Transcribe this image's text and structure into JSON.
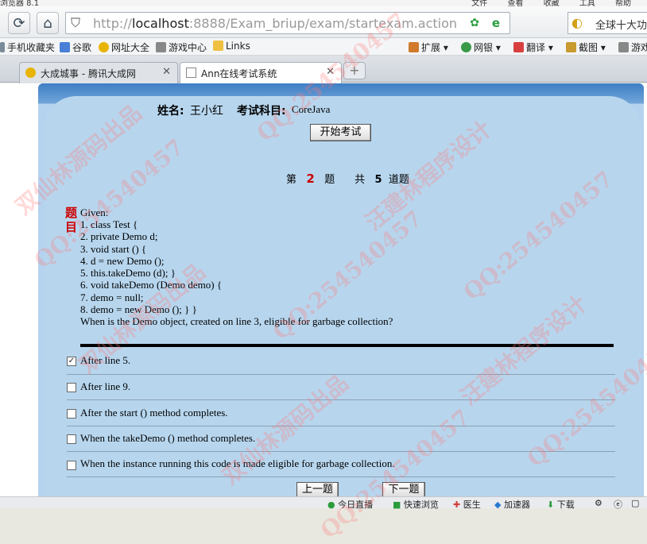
{
  "menubar": {
    "left_text": "浏览器 8.1",
    "right_items": [
      "文件",
      "查看",
      "收藏",
      "工具",
      "帮助"
    ]
  },
  "navbar": {
    "url_host": "localhost",
    "url_rest": ":8888/Exam_briup/exam/startexam.action",
    "url_prefix": "http://",
    "search_text": "全球十大功"
  },
  "bookmarks": [
    "手机收藏夹",
    "谷歌",
    "网址大全",
    "游戏中心",
    "Links"
  ],
  "bookmarks_right": [
    "扩展",
    "网银",
    "翻译",
    "截图",
    "游戏"
  ],
  "tabs": [
    {
      "label": "大成城事 - 腾讯大成网"
    },
    {
      "label": "Ann在线考试系统"
    }
  ],
  "exam": {
    "name_label": "姓名:",
    "name_value": "王小红",
    "subject_label": "考试科目:",
    "subject_value": "CoreJava",
    "start_button": "开始考试",
    "q_prefix": "第",
    "q_number": "2",
    "q_mid": "题",
    "total_prefix": "共",
    "total_number": "5",
    "total_suffix": "道题",
    "question_tag": "题目",
    "question_lines": [
      "Given:",
      "1. class Test {",
      "2. private Demo d;",
      "3. void start () {",
      "4. d = new Demo ();",
      "5. this.takeDemo (d); }",
      "6. void takeDemo (Demo demo) {",
      "7. demo = null;",
      "8. demo = new Demo (); } }",
      "When is the Demo object, created on line 3, eligible for garbage collection?"
    ],
    "options": [
      {
        "label": "After line 5.",
        "checked": true
      },
      {
        "label": "After line 9.",
        "checked": false
      },
      {
        "label": "After the start () method completes.",
        "checked": false
      },
      {
        "label": "When the takeDemo () method completes.",
        "checked": false
      },
      {
        "label": "When the instance running this code is made eligible for garbage collection.",
        "checked": false
      }
    ],
    "prev_button": "上一题",
    "next_button": "下一题"
  },
  "statusbar": [
    "今日直播",
    "快速浏览",
    "医生",
    "加速器",
    "下载"
  ],
  "watermarks": [
    "QQ:254540457",
    "汪建林程序设计",
    "双仙林源码出品"
  ]
}
